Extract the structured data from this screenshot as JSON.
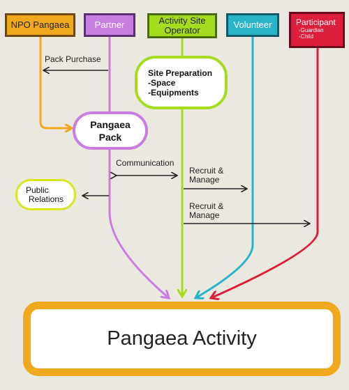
{
  "headers": {
    "npo": "NPO Pangaea",
    "partner": "Partner",
    "operator_line1": "Activity Site",
    "operator_line2": "Operator",
    "volunteer": "Volunteer",
    "participant": "Participant",
    "participant_sub1": "-Guardian",
    "participant_sub2": "-Child"
  },
  "site_prep": {
    "title": "Site Preparation",
    "item1": "-Space",
    "item2": "-Equipments"
  },
  "pack": {
    "line1": "Pangaea",
    "line2": "Pack"
  },
  "public_relations": {
    "line1": "Public",
    "line2": "Relations"
  },
  "labels": {
    "pack_purchase": "Pack Purchase",
    "communication": "Communication",
    "recruit1_line1": "Recruit &",
    "recruit1_line2": "Manage",
    "recruit2_line1": "Recruit &",
    "recruit2_line2": "Manage"
  },
  "activity": "Pangaea Activity",
  "colors": {
    "npo": "#f0a81e",
    "partner": "#c87de0",
    "operator": "#a6dc1e",
    "volunteer": "#28b4c8",
    "participant": "#dc1e3c",
    "arrow": "#222222"
  }
}
